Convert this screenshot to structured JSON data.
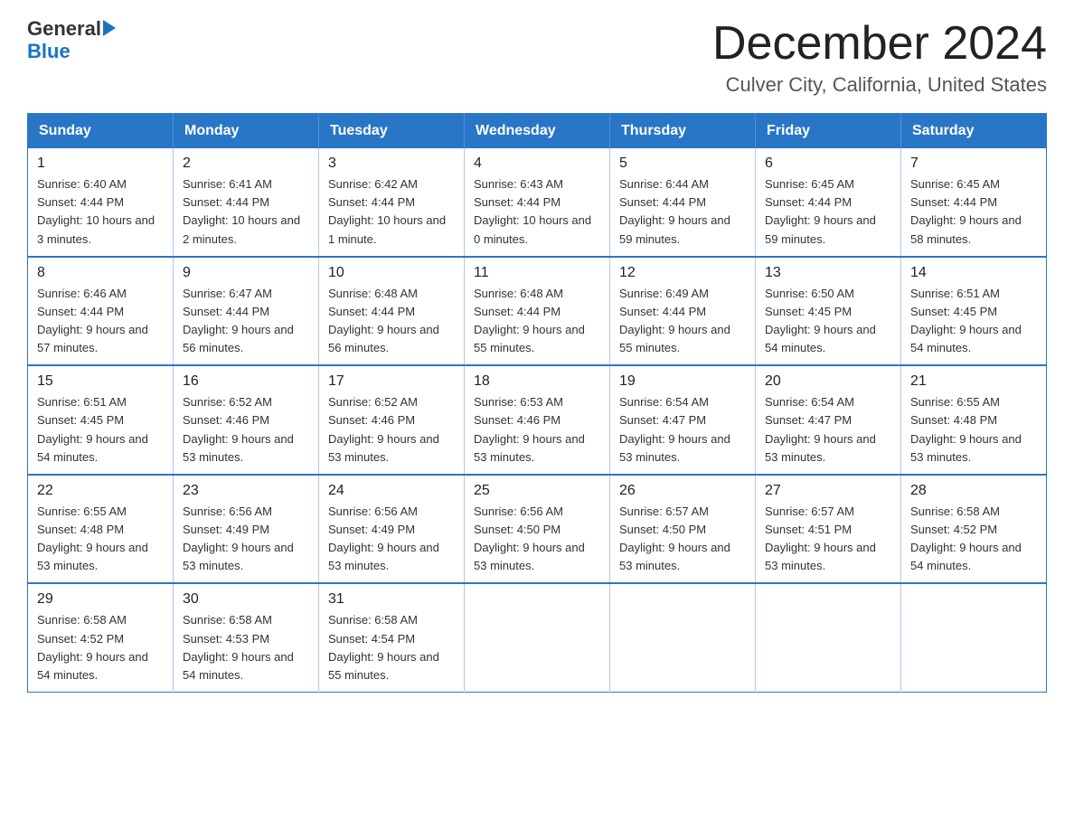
{
  "header": {
    "logo_line1": "General",
    "logo_line2": "Blue",
    "title": "December 2024",
    "subtitle": "Culver City, California, United States"
  },
  "weekdays": [
    "Sunday",
    "Monday",
    "Tuesday",
    "Wednesday",
    "Thursday",
    "Friday",
    "Saturday"
  ],
  "weeks": [
    [
      {
        "day": "1",
        "sunrise": "6:40 AM",
        "sunset": "4:44 PM",
        "daylight": "10 hours and 3 minutes."
      },
      {
        "day": "2",
        "sunrise": "6:41 AM",
        "sunset": "4:44 PM",
        "daylight": "10 hours and 2 minutes."
      },
      {
        "day": "3",
        "sunrise": "6:42 AM",
        "sunset": "4:44 PM",
        "daylight": "10 hours and 1 minute."
      },
      {
        "day": "4",
        "sunrise": "6:43 AM",
        "sunset": "4:44 PM",
        "daylight": "10 hours and 0 minutes."
      },
      {
        "day": "5",
        "sunrise": "6:44 AM",
        "sunset": "4:44 PM",
        "daylight": "9 hours and 59 minutes."
      },
      {
        "day": "6",
        "sunrise": "6:45 AM",
        "sunset": "4:44 PM",
        "daylight": "9 hours and 59 minutes."
      },
      {
        "day": "7",
        "sunrise": "6:45 AM",
        "sunset": "4:44 PM",
        "daylight": "9 hours and 58 minutes."
      }
    ],
    [
      {
        "day": "8",
        "sunrise": "6:46 AM",
        "sunset": "4:44 PM",
        "daylight": "9 hours and 57 minutes."
      },
      {
        "day": "9",
        "sunrise": "6:47 AM",
        "sunset": "4:44 PM",
        "daylight": "9 hours and 56 minutes."
      },
      {
        "day": "10",
        "sunrise": "6:48 AM",
        "sunset": "4:44 PM",
        "daylight": "9 hours and 56 minutes."
      },
      {
        "day": "11",
        "sunrise": "6:48 AM",
        "sunset": "4:44 PM",
        "daylight": "9 hours and 55 minutes."
      },
      {
        "day": "12",
        "sunrise": "6:49 AM",
        "sunset": "4:44 PM",
        "daylight": "9 hours and 55 minutes."
      },
      {
        "day": "13",
        "sunrise": "6:50 AM",
        "sunset": "4:45 PM",
        "daylight": "9 hours and 54 minutes."
      },
      {
        "day": "14",
        "sunrise": "6:51 AM",
        "sunset": "4:45 PM",
        "daylight": "9 hours and 54 minutes."
      }
    ],
    [
      {
        "day": "15",
        "sunrise": "6:51 AM",
        "sunset": "4:45 PM",
        "daylight": "9 hours and 54 minutes."
      },
      {
        "day": "16",
        "sunrise": "6:52 AM",
        "sunset": "4:46 PM",
        "daylight": "9 hours and 53 minutes."
      },
      {
        "day": "17",
        "sunrise": "6:52 AM",
        "sunset": "4:46 PM",
        "daylight": "9 hours and 53 minutes."
      },
      {
        "day": "18",
        "sunrise": "6:53 AM",
        "sunset": "4:46 PM",
        "daylight": "9 hours and 53 minutes."
      },
      {
        "day": "19",
        "sunrise": "6:54 AM",
        "sunset": "4:47 PM",
        "daylight": "9 hours and 53 minutes."
      },
      {
        "day": "20",
        "sunrise": "6:54 AM",
        "sunset": "4:47 PM",
        "daylight": "9 hours and 53 minutes."
      },
      {
        "day": "21",
        "sunrise": "6:55 AM",
        "sunset": "4:48 PM",
        "daylight": "9 hours and 53 minutes."
      }
    ],
    [
      {
        "day": "22",
        "sunrise": "6:55 AM",
        "sunset": "4:48 PM",
        "daylight": "9 hours and 53 minutes."
      },
      {
        "day": "23",
        "sunrise": "6:56 AM",
        "sunset": "4:49 PM",
        "daylight": "9 hours and 53 minutes."
      },
      {
        "day": "24",
        "sunrise": "6:56 AM",
        "sunset": "4:49 PM",
        "daylight": "9 hours and 53 minutes."
      },
      {
        "day": "25",
        "sunrise": "6:56 AM",
        "sunset": "4:50 PM",
        "daylight": "9 hours and 53 minutes."
      },
      {
        "day": "26",
        "sunrise": "6:57 AM",
        "sunset": "4:50 PM",
        "daylight": "9 hours and 53 minutes."
      },
      {
        "day": "27",
        "sunrise": "6:57 AM",
        "sunset": "4:51 PM",
        "daylight": "9 hours and 53 minutes."
      },
      {
        "day": "28",
        "sunrise": "6:58 AM",
        "sunset": "4:52 PM",
        "daylight": "9 hours and 54 minutes."
      }
    ],
    [
      {
        "day": "29",
        "sunrise": "6:58 AM",
        "sunset": "4:52 PM",
        "daylight": "9 hours and 54 minutes."
      },
      {
        "day": "30",
        "sunrise": "6:58 AM",
        "sunset": "4:53 PM",
        "daylight": "9 hours and 54 minutes."
      },
      {
        "day": "31",
        "sunrise": "6:58 AM",
        "sunset": "4:54 PM",
        "daylight": "9 hours and 55 minutes."
      },
      null,
      null,
      null,
      null
    ]
  ]
}
